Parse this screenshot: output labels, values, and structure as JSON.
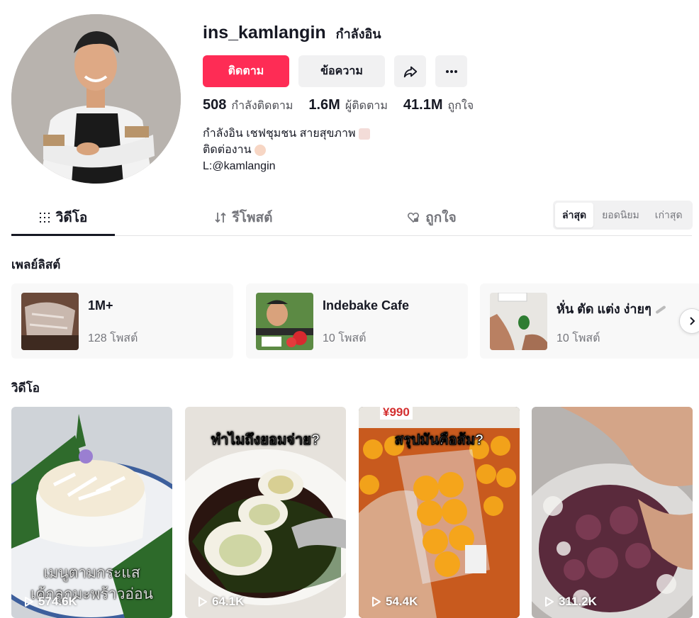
{
  "profile": {
    "username": "ins_kamlangin",
    "nickname": "กำลังอิน",
    "follow_label": "ติดตาม",
    "message_label": "ข้อความ",
    "stats": [
      {
        "value": "508",
        "label": "กำลังติดตาม"
      },
      {
        "value": "1.6M",
        "label": "ผู้ติดตาม"
      },
      {
        "value": "41.1M",
        "label": "ถูกใจ"
      }
    ],
    "bio": [
      "กำลังอิน เชฟชุมชน สายสุขภาพ",
      "ติดต่องาน",
      "L:@kamlangin"
    ]
  },
  "tabs": [
    {
      "label": "วิดีโอ",
      "icon": "grid-icon"
    },
    {
      "label": "รีโพสต์",
      "icon": "repost-icon"
    },
    {
      "label": "ถูกใจ",
      "icon": "heart-lock-icon"
    }
  ],
  "sort": [
    "ล่าสุด",
    "ยอดนิยม",
    "เก่าสุด"
  ],
  "playlists_title": "เพลย์ลิสต์",
  "playlists": [
    {
      "name": "1M+",
      "count": "128 โพสต์"
    },
    {
      "name": "Indebake Cafe",
      "count": "10 โพสต์"
    },
    {
      "name": "หั่น ตัด แต่ง ง่ายๆ",
      "count": "10 โพสต์"
    }
  ],
  "videos_title": "วิดีโอ",
  "videos": [
    {
      "caption_top": "",
      "caption_bottom_1": "เมนูตามกระแส",
      "caption_bottom_2": "เค้กลูกมะพร้าวอ่อน",
      "views": "574.6K"
    },
    {
      "caption_top": "ทำไมถึงยอมจ่าย?",
      "views": "64.1K"
    },
    {
      "caption_top": "สรุปมันคือส้ม?",
      "price_tag": "¥990",
      "views": "54.4K"
    },
    {
      "caption_top": "",
      "views": "311.2K"
    }
  ],
  "colors": {
    "accent": "#fe2c55",
    "text": "#161823",
    "muted": "#75767c",
    "surface": "#f1f1f2"
  }
}
